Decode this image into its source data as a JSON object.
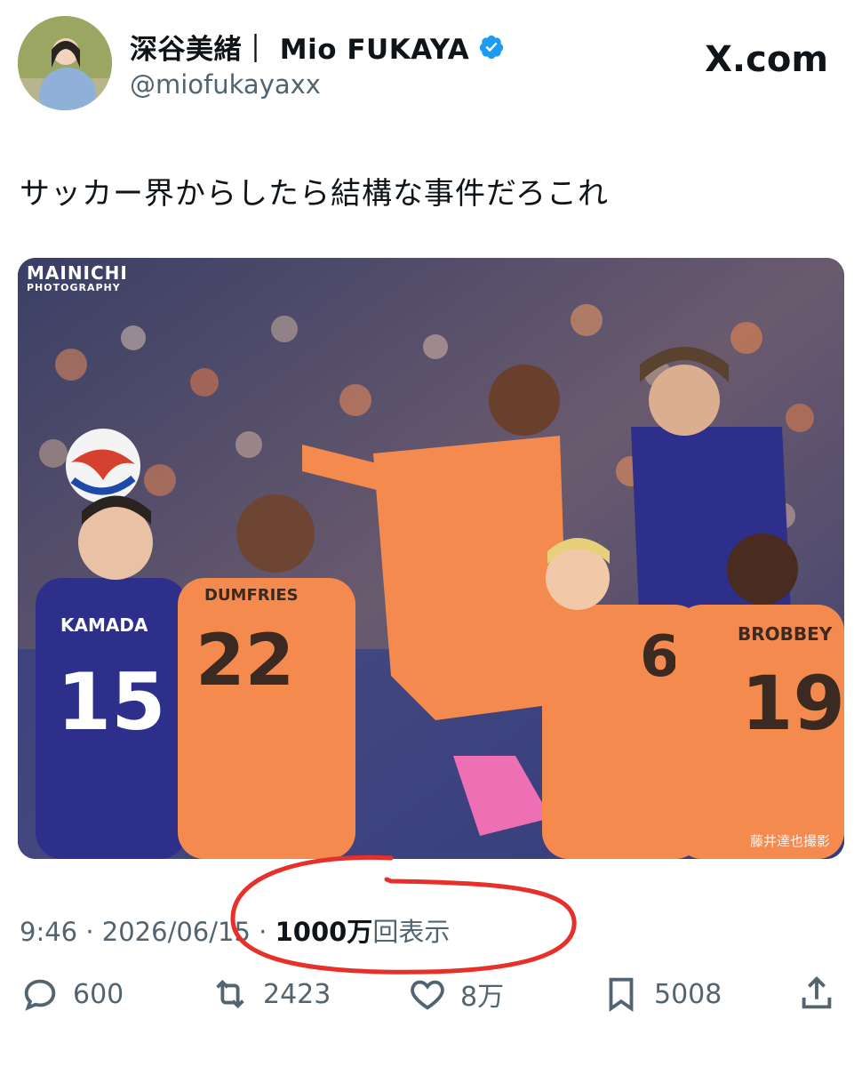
{
  "author": {
    "display_name": "深谷美緒｜ Mio FUKAYA",
    "handle": "@miofukayaxx",
    "verified": true
  },
  "site_logo": "X.com",
  "tweet": {
    "text": "サッカー界からしたら結構な事件だろこれ"
  },
  "photo": {
    "watermark_line1": "MAINICHI",
    "watermark_line2": "PHOTOGRAPHY",
    "credit": "藤井達也撮影",
    "jersey_texts": [
      "KAMADA",
      "15",
      "DUMFRIES",
      "22",
      "BROBBEY",
      "19",
      "6"
    ]
  },
  "meta": {
    "time": "9:46",
    "date": "2026/06/15",
    "sep": "·",
    "views_count": "1000万",
    "views_label": "回表示"
  },
  "annotation_color": "#e8302a",
  "actions": {
    "replies": "600",
    "reposts": "2423",
    "likes": "8万",
    "bookmarks": "5008"
  },
  "icons": [
    "verified-badge-icon",
    "reply-icon",
    "repost-icon",
    "like-icon",
    "bookmark-icon",
    "share-icon"
  ],
  "colors": {
    "verified": "#1d9bf0",
    "text": "#0f1419",
    "secondary": "#536471",
    "netherlands_orange": "#f58a4e",
    "japan_blue": "#2a2f8f"
  }
}
